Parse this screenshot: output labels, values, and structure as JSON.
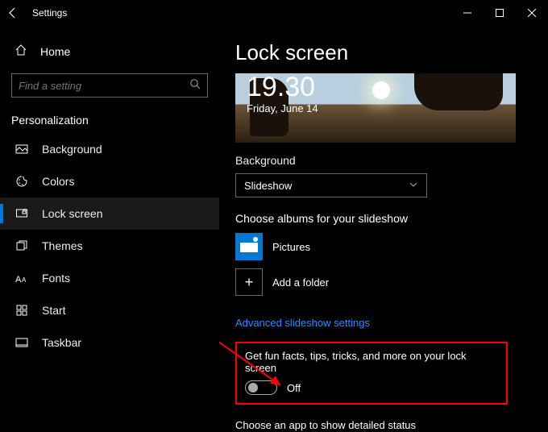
{
  "titlebar": {
    "label": "Settings"
  },
  "sidebar": {
    "home": "Home",
    "search_placeholder": "Find a setting",
    "category": "Personalization",
    "items": [
      {
        "label": "Background",
        "icon": "background-icon"
      },
      {
        "label": "Colors",
        "icon": "colors-icon"
      },
      {
        "label": "Lock screen",
        "icon": "lockscreen-icon",
        "active": true
      },
      {
        "label": "Themes",
        "icon": "themes-icon"
      },
      {
        "label": "Fonts",
        "icon": "fonts-icon"
      },
      {
        "label": "Start",
        "icon": "start-icon"
      },
      {
        "label": "Taskbar",
        "icon": "taskbar-icon"
      }
    ]
  },
  "main": {
    "title": "Lock screen",
    "preview": {
      "time": "19.30",
      "date": "Friday, June 14"
    },
    "background_label": "Background",
    "background_value": "Slideshow",
    "albums_label": "Choose albums for your slideshow",
    "album_rows": [
      {
        "label": "Pictures"
      },
      {
        "label": "Add a folder"
      }
    ],
    "advanced_link": "Advanced slideshow settings",
    "fun_facts_label": "Get fun facts, tips, tricks, and more on your lock screen",
    "fun_facts_state": "Off",
    "detailed_status_label": "Choose an app to show detailed status"
  }
}
